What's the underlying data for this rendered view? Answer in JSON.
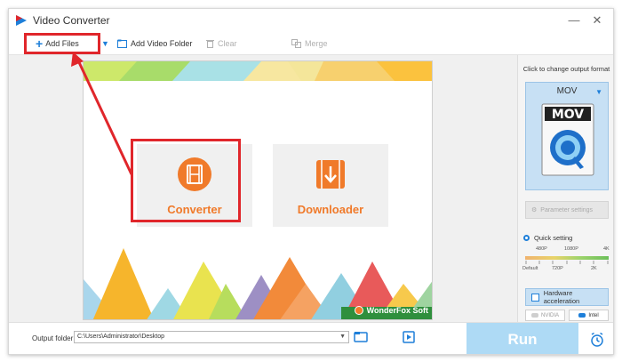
{
  "window": {
    "title": "Video Converter"
  },
  "toolbar": {
    "add_files": "Add Files",
    "add_video_folder": "Add Video Folder",
    "clear": "Clear",
    "merge": "Merge"
  },
  "home": {
    "converter": "Converter",
    "downloader": "Downloader",
    "brand": "WonderFox Soft"
  },
  "output_panel": {
    "hint": "Click to change output format",
    "format": "MOV",
    "format_icon_text": "MOV",
    "parameter_settings": "Parameter settings",
    "quick_setting": "Quick setting",
    "quality_top": [
      "480P",
      "1080P",
      "4K"
    ],
    "quality_bottom": [
      "Default",
      "720P",
      "2K"
    ],
    "hardware_acceleration": "Hardware acceleration",
    "gpu_nvidia": "NVIDIA",
    "gpu_intel": "Intel"
  },
  "bottom": {
    "output_folder_label": "Output folder:",
    "output_folder_value": "C:\\Users\\Administrator\\Desktop",
    "run": "Run"
  },
  "colors": {
    "accent_blue": "#1e7fd9",
    "brand_orange": "#f07a2a",
    "highlight_red": "#e0262b",
    "run_button": "#aedaf5"
  },
  "icons": [
    "app-logo-icon",
    "plus-icon",
    "dropdown-icon",
    "folder-add-icon",
    "trash-icon",
    "merge-icon",
    "film-icon",
    "download-icon",
    "fox-logo-icon",
    "quicktime-icon",
    "settings-icon",
    "chip-icon",
    "folder-open-icon",
    "preview-icon",
    "alarm-clock-icon"
  ]
}
